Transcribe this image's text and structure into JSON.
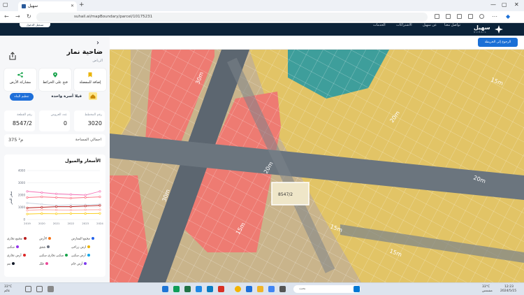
{
  "browser": {
    "tab_title": "سهيل",
    "url": "suhail.ai/mapBoundary/parcel/10175231"
  },
  "site_header": {
    "pill_label": "تسجيل الدخول",
    "nav_links": [
      "الخدمات",
      "الاشتراكات",
      "عن سهيل",
      "تواصل معنا"
    ],
    "logo_ar": "سهيل",
    "logo_en": "SUHAIL"
  },
  "panel": {
    "title": "ضاحية نمار",
    "subtitle": "الرياض",
    "actions": [
      {
        "label": "مشاركة الأرض",
        "icon": "share-icon"
      },
      {
        "label": "فتح على الخرائط",
        "icon": "map-pin-icon"
      },
      {
        "label": "إضافة للمفضلة",
        "icon": "bookmark-icon"
      }
    ],
    "family": {
      "text": "فيلا أسرة واحدة",
      "button": "تنظيم البناء"
    },
    "stats": [
      {
        "label": "رقم القطعة",
        "value": "8547/2"
      },
      {
        "label": "عدد العروض",
        "value": "0"
      },
      {
        "label": "رقم المخطط",
        "value": "3020"
      }
    ],
    "area": {
      "label": "اجمالي المساحة",
      "value": "375 م²"
    },
    "chart_title": "الأسعار والميول",
    "legend": [
      {
        "label": "مجمع المعارض",
        "color": "#2563eb"
      },
      {
        "label": "الأرض",
        "color": "#f97316"
      },
      {
        "label": "مجمع تجاري",
        "color": "#b91c1c"
      },
      {
        "label": "ارض زراعي",
        "color": "#eab308"
      },
      {
        "label": "شقق",
        "color": "#6b7280"
      },
      {
        "label": "سكني",
        "color": "#9333ea"
      },
      {
        "label": "أرض سكني",
        "color": "#0ea5e9"
      },
      {
        "label": "سكني تجاري سكني",
        "color": "#16a34a"
      },
      {
        "label": "أرض تجاري",
        "color": "#dc2626"
      },
      {
        "label": "أرض خام",
        "color": "#7c3aed"
      },
      {
        "label": "فلل",
        "color": "#ec4899"
      },
      {
        "label": "مم",
        "color": "#111827"
      }
    ]
  },
  "chart_data": {
    "type": "line",
    "title": "الأسعار والميول",
    "ylabel": "سعر المتر",
    "ylim": [
      0,
      4000
    ],
    "yticks": [
      "4000",
      "3000",
      "2000",
      "1000",
      "0"
    ],
    "categories": [
      "2019",
      "2020",
      "2021",
      "2022",
      "2023",
      "2024"
    ],
    "series": [
      {
        "name": "",
        "color": "#f472b6",
        "values": [
          2300,
          2200,
          2100,
          2050,
          2000,
          2300
        ]
      },
      {
        "name": "",
        "color": "#fb7185",
        "values": [
          1800,
          1850,
          1800,
          1750,
          1800,
          1850
        ]
      },
      {
        "name": "",
        "color": "#cbd5e1",
        "values": [
          1350,
          1250,
          1150,
          1200,
          1200,
          1250
        ]
      },
      {
        "name": "",
        "color": "#b91c1c",
        "values": [
          950,
          1000,
          1050,
          1050,
          1100,
          1150
        ]
      },
      {
        "name": "",
        "color": "#fca5a5",
        "values": [
          750,
          800,
          780,
          770,
          790,
          800
        ]
      },
      {
        "name": "",
        "color": "#facc15",
        "values": [
          450,
          480,
          470,
          480,
          480,
          500
        ]
      }
    ]
  },
  "map": {
    "button_label": "الرجوع إلى الخريطة",
    "selected_parcel": "8547/2",
    "street_labels": [
      "30m",
      "30m",
      "20m",
      "20m",
      "15m",
      "15m",
      "15m",
      "15m",
      "20m"
    ]
  },
  "taskbar": {
    "search_placeholder": "بحث",
    "weather": "33°C",
    "weather_desc": "مشمس",
    "time": "12:23",
    "date": "2024/5/15",
    "temp_left": "33°C",
    "weather_left": "غائم"
  }
}
